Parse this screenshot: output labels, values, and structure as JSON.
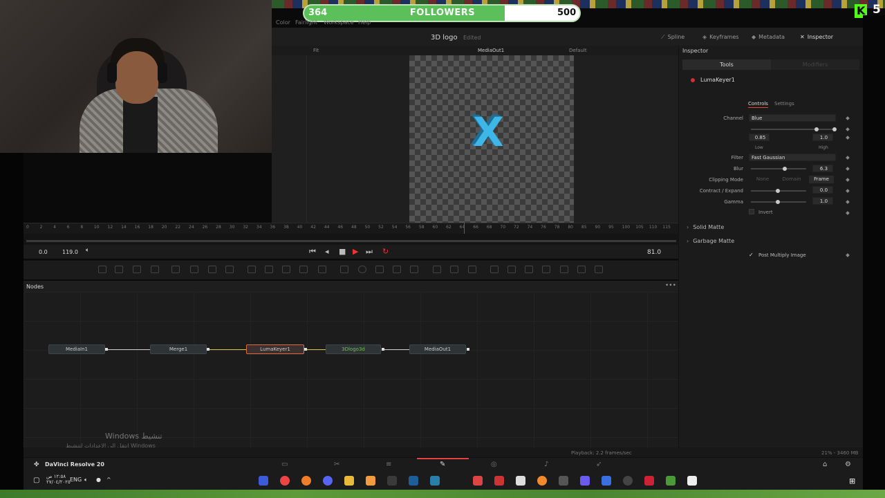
{
  "stream": {
    "followers": {
      "current": "364",
      "label": "FOLLOWERS",
      "goal": "500",
      "progress": 0.728
    },
    "kick": {
      "logo": "K",
      "count": "5"
    }
  },
  "menu": {
    "items": [
      "Color",
      "Fairlight",
      "Workspace",
      "Help"
    ]
  },
  "header": {
    "project_title": "3D logo",
    "project_state": "Edited",
    "buttons": {
      "spline": "Spline",
      "keyframes": "Keyframes",
      "metadata": "Metadata",
      "inspector": "Inspector"
    }
  },
  "viewer": {
    "fit": "Fit",
    "output_name": "MediaOut1",
    "lut": "Default",
    "logo_glyph": "X"
  },
  "inspector": {
    "title": "Inspector",
    "tabs": {
      "tools": "Tools",
      "modifiers": "Modifiers"
    },
    "node_name": "LumaKeyer1",
    "subtabs": {
      "controls": "Controls",
      "settings": "Settings"
    },
    "params": {
      "channel_label": "Channel",
      "channel_value": "Blue",
      "low_value": "0.85",
      "high_value": "1.0",
      "low_label": "Low",
      "high_label": "High",
      "filter_label": "Filter",
      "filter_value": "Fast Gaussian",
      "blur_label": "Blur",
      "blur_value": "6.3",
      "clipping_label": "Clipping Mode",
      "clip_none": "None",
      "clip_domain": "Domain",
      "clip_frame": "Frame",
      "contract_label": "Contract / Expand",
      "contract_value": "0.0",
      "gamma_label": "Gamma",
      "gamma_value": "1.0",
      "invert_label": "Invert"
    },
    "sections": {
      "solid_matte": "Solid Matte",
      "garbage_matte": "Garbage Matte",
      "post_multiply": "Post Multiply Image"
    }
  },
  "timeline": {
    "ruler_ticks": [
      "0",
      "2",
      "4",
      "6",
      "8",
      "10",
      "12",
      "14",
      "16",
      "18",
      "20",
      "22",
      "24",
      "26",
      "28",
      "30",
      "32",
      "34",
      "36",
      "38",
      "40",
      "42",
      "44",
      "46",
      "48",
      "50",
      "52",
      "54",
      "56",
      "58",
      "60",
      "62",
      "64",
      "66",
      "68",
      "70",
      "72",
      "74",
      "76",
      "78",
      "80",
      "85",
      "90",
      "95",
      "100",
      "105",
      "110",
      "115"
    ],
    "start": "0.0",
    "end": "119.0",
    "current": "81.0"
  },
  "nodes": {
    "title": "Nodes",
    "items": [
      "MediaIn1",
      "Merge1",
      "LumaKeyer1",
      "3Dlogo3d",
      "MediaOut1"
    ]
  },
  "status": {
    "playback": "Playback: 2.2 frames/sec",
    "memory": "21% - 3460 MB",
    "watermark_title": "Windows تنشيط",
    "watermark_sub": "انتقل إلى الإعدادات لتنشيط Windows"
  },
  "app": {
    "name": "DaVinci Resolve 20"
  },
  "taskbar": {
    "time": "١٢:٥٨ ص",
    "date": "٢٧/٠٤/٢٠٢٥",
    "lang": "ENG"
  }
}
